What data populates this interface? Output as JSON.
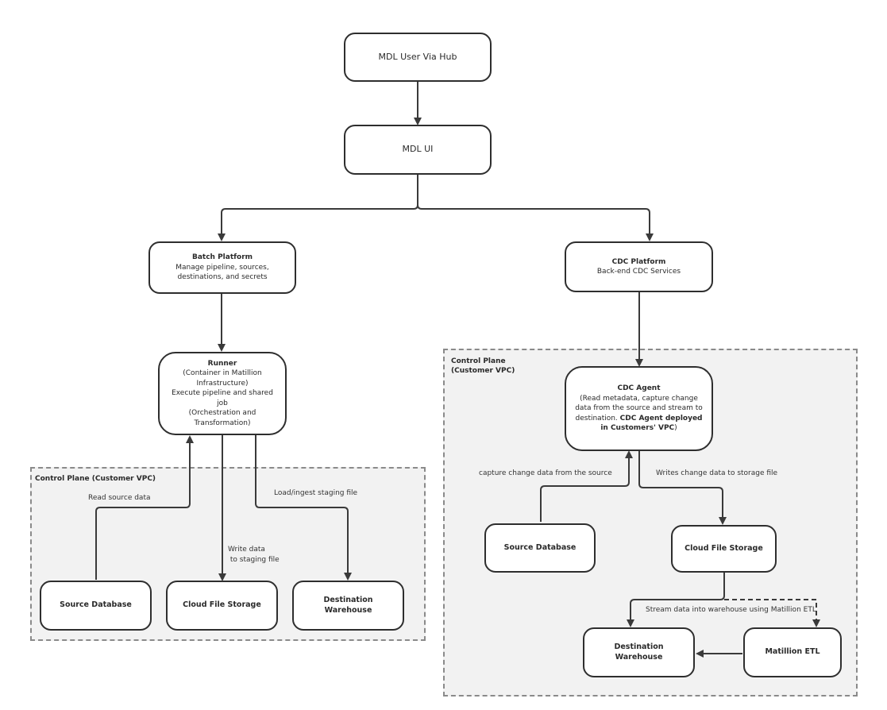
{
  "nodes": {
    "mdl_user": {
      "label": "MDL User Via Hub"
    },
    "mdl_ui": {
      "label": "MDL UI"
    },
    "batch_platform": {
      "title": "Batch Platform",
      "description": "Manage pipeline, sources, destinations, and secrets"
    },
    "cdc_platform": {
      "title": "CDC Platform",
      "description": "Back-end CDC Services"
    },
    "runner": {
      "title": "Runner",
      "description_lines": [
        "(Container in Matillion Infrastructure)",
        "Execute pipeline and shared job",
        "(Orchestration and Transformation)"
      ]
    },
    "cdc_agent": {
      "title": "CDC Agent",
      "description": "(Read metadata, capture change data from the source and stream to destination. ",
      "description_bold": "CDC Agent deployed in Customers' VPC",
      "description_end": ")"
    },
    "batch_source_db": {
      "label": "Source Database"
    },
    "batch_cloud_storage": {
      "label": "Cloud File Storage"
    },
    "batch_dest_warehouse": {
      "label": "Destination Warehouse"
    },
    "cdc_source_db": {
      "label": "Source Database"
    },
    "cdc_cloud_storage": {
      "label": "Cloud File Storage"
    },
    "cdc_dest_warehouse": {
      "label": "Destination Warehouse"
    },
    "matillion_etl": {
      "label": "Matillion ETL"
    }
  },
  "zones": {
    "batch_control_plane": {
      "label": "Control Plane (Customer VPC)"
    },
    "cdc_control_plane": {
      "label": "Control Plane\n(Customer VPC)",
      "label_line1": "Control Plane",
      "label_line2": "(Customer VPC)"
    }
  },
  "edge_labels": {
    "read_source_data": "Read source data",
    "write_data_line1": "Write data",
    "write_data_line2": " to staging file",
    "load_ingest": "Load/ingest staging file",
    "capture_change": "capture change data from the source",
    "writes_change": "Writes change data to storage file",
    "stream_data": "Stream data into warehouse using Matillion ETL"
  },
  "colors": {
    "zone_fill": "#f2f2f2",
    "zone_border": "#8a8a8a",
    "stroke": "#2e2e2e"
  }
}
